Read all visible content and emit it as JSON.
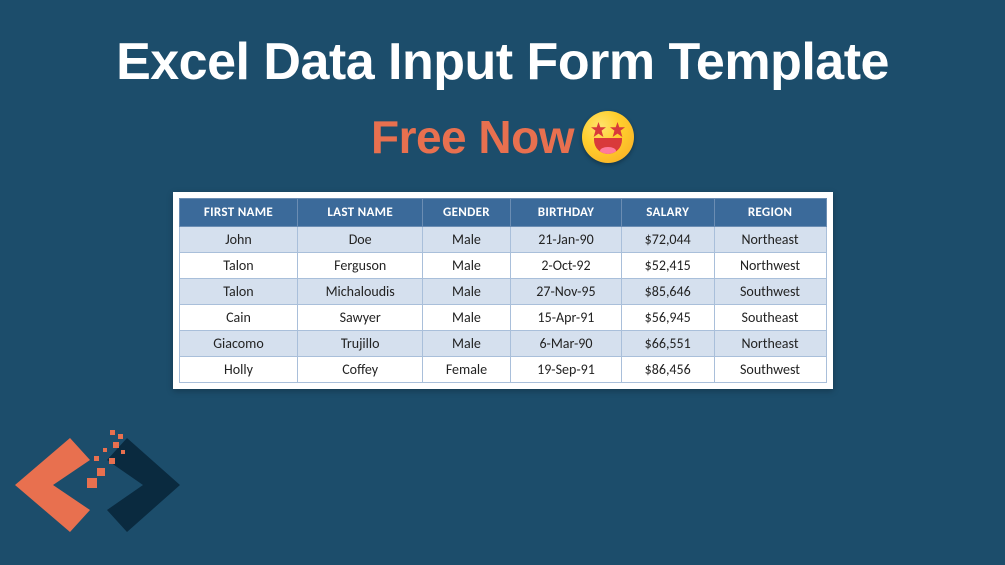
{
  "title": "Excel Data Input Form Template",
  "subtitle": "Free Now",
  "emoji_name": "star-struck",
  "table": {
    "headers": [
      "FIRST NAME",
      "LAST NAME",
      "GENDER",
      "BIRTHDAY",
      "SALARY",
      "REGION"
    ],
    "rows": [
      {
        "first": "John",
        "last": "Doe",
        "gender": "Male",
        "birthday": "21-Jan-90",
        "salary": "$72,044",
        "region": "Northeast"
      },
      {
        "first": "Talon",
        "last": "Ferguson",
        "gender": "Male",
        "birthday": "2-Oct-92",
        "salary": "$52,415",
        "region": "Northwest"
      },
      {
        "first": "Talon",
        "last": "Michaloudis",
        "gender": "Male",
        "birthday": "27-Nov-95",
        "salary": "$85,646",
        "region": "Southwest"
      },
      {
        "first": "Cain",
        "last": "Sawyer",
        "gender": "Male",
        "birthday": "15-Apr-91",
        "salary": "$56,945",
        "region": "Southeast"
      },
      {
        "first": "Giacomo",
        "last": "Trujillo",
        "gender": "Male",
        "birthday": "6-Mar-90",
        "salary": "$66,551",
        "region": "Northeast"
      },
      {
        "first": "Holly",
        "last": "Coffey",
        "gender": "Female",
        "birthday": "19-Sep-91",
        "salary": "$86,456",
        "region": "Southwest"
      }
    ]
  }
}
